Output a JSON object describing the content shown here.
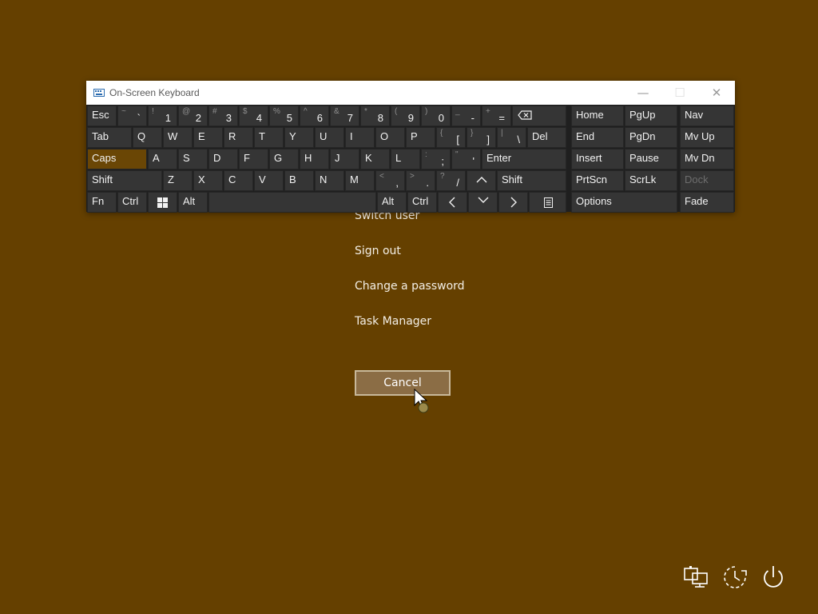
{
  "menu": {
    "items": [
      "Switch user",
      "Sign out",
      "Change a password",
      "Task Manager"
    ],
    "cancel_label": "Cancel"
  },
  "osk": {
    "title": "On-Screen Keyboard",
    "keys": {
      "esc": "Esc",
      "tilde_sec": "~",
      "tilde_pri": "`",
      "n1s": "!",
      "n1": "1",
      "n2s": "@",
      "n2": "2",
      "n3s": "#",
      "n3": "3",
      "n4s": "$",
      "n4": "4",
      "n5s": "%",
      "n5": "5",
      "n6s": "^",
      "n6": "6",
      "n7s": "&",
      "n7": "7",
      "n8s": "*",
      "n8": "8",
      "n9s": "(",
      "n9": "9",
      "n0s": ")",
      "n0": "0",
      "minus_s": "_",
      "minus": "-",
      "eq_s": "+",
      "eq": "=",
      "tab": "Tab",
      "q": "Q",
      "w": "W",
      "e": "E",
      "r": "R",
      "t": "T",
      "y": "Y",
      "u": "U",
      "i": "I",
      "o": "O",
      "p": "P",
      "lbr_s": "{",
      "lbr": "[",
      "rbr_s": "}",
      "rbr": "]",
      "bsl_s": "|",
      "bsl": "\\",
      "del": "Del",
      "caps": "Caps",
      "a": "A",
      "s": "S",
      "d": "D",
      "f": "F",
      "g": "G",
      "h": "H",
      "j": "J",
      "k": "K",
      "l": "L",
      "semi_s": ":",
      "semi": ";",
      "quote_s": "\"",
      "quote": "'",
      "enter": "Enter",
      "shift": "Shift",
      "z": "Z",
      "x": "X",
      "c": "C",
      "v": "V",
      "b": "B",
      "n": "N",
      "m": "M",
      "comma_s": "<",
      "comma": ",",
      "period_s": ">",
      "period": ".",
      "slash_s": "?",
      "slash": "/",
      "fn": "Fn",
      "ctrl": "Ctrl",
      "alt": "Alt",
      "home": "Home",
      "pgup": "PgUp",
      "nav": "Nav",
      "end": "End",
      "pgdn": "PgDn",
      "mvup": "Mv Up",
      "insert": "Insert",
      "pause": "Pause",
      "mvdn": "Mv Dn",
      "prtscn": "PrtScn",
      "scrlk": "ScrLk",
      "dock": "Dock",
      "options": "Options",
      "fade": "Fade"
    }
  },
  "colors": {
    "background": "#654000",
    "caps_active": "#6a4605",
    "key": "#353535"
  },
  "icons": [
    "network-icon",
    "ease-of-access-icon",
    "power-icon",
    "backspace-icon",
    "windows-logo-icon",
    "keyboard-icon"
  ]
}
